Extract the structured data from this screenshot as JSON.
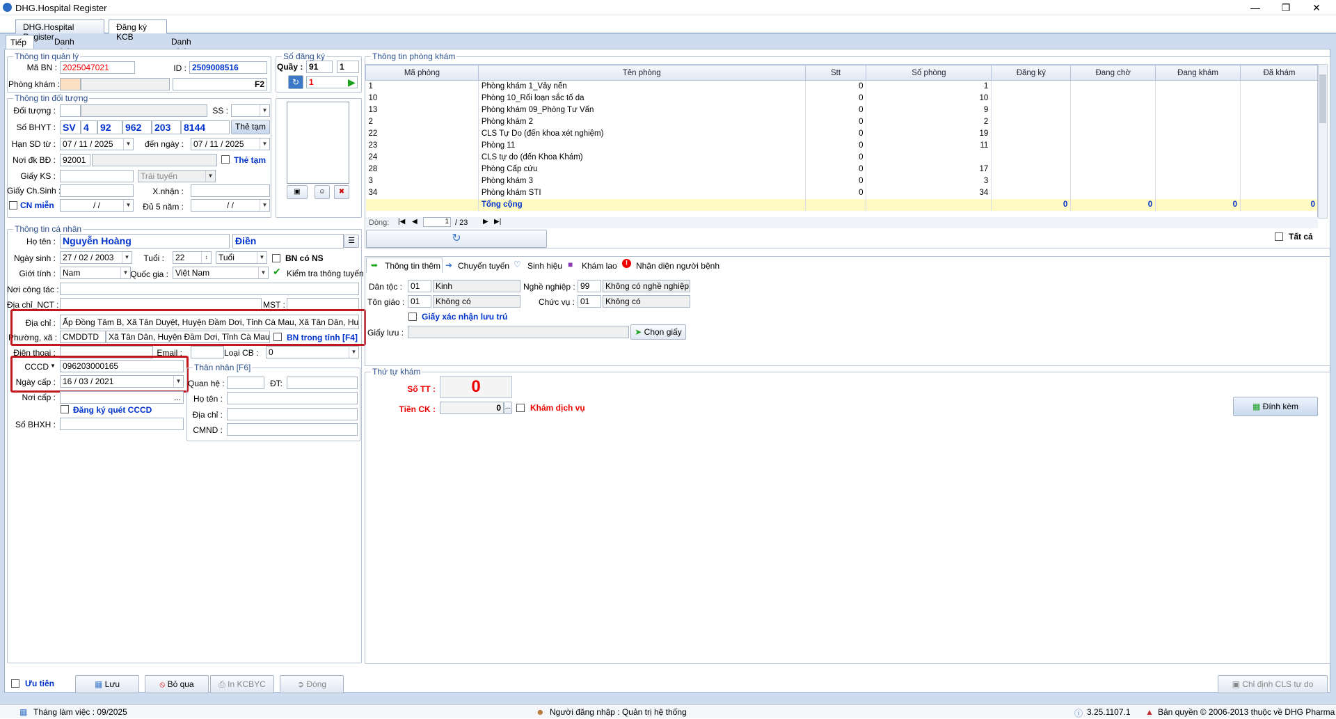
{
  "app": {
    "title": "DHG.Hospital Register"
  },
  "tabs": [
    "DHG.Hospital Register",
    "Đăng ký KCB"
  ],
  "subtabs": [
    "Tiếp nhận",
    "Danh sách bệnh nhân đăng ký",
    "Danh sách bệnh nhân WEB"
  ],
  "quanly": {
    "caption": "Thông tin quản lý",
    "ma_bn_label": "Mã BN :",
    "ma_bn": "2025047021",
    "id_label": "ID :",
    "id": "2509008516",
    "phong_kham_label": "Phòng khám :",
    "f2": "F2"
  },
  "sodangky": {
    "caption": "Số đăng ký",
    "quay_label": "Quầy :",
    "quay": "91",
    "quay2": "1",
    "so": "1"
  },
  "doituong": {
    "caption": "Thông tin đối tượng",
    "doi_tuong_label": "Đối tượng :",
    "ss_label": "SS :",
    "so_bhyt_label": "Số BHYT :",
    "bhyt": [
      "SV",
      "4",
      "92",
      "962",
      "203",
      "8144"
    ],
    "the_tam_btn": "Thẻ tạm",
    "han_sd_label": "Hạn SD từ :",
    "han_tu": "07 / 11 / 2025",
    "den_ngay_label": "đến ngày :",
    "han_den": "07 / 11 / 2025",
    "noi_dk_label": "Nơi đk BĐ :",
    "noi_dk": "92001",
    "the_tam_chk": "Thẻ tạm",
    "giay_ks_label": "Giấy KS :",
    "trai_tuyen": "Trái tuyến",
    "giay_chsinh_label": "Giấy Ch.Sinh :",
    "xnhan_label": "X.nhận :",
    "cn_mien": "CN miễn",
    "cn_date": "  /    /",
    "du5nam_label": "Đủ 5 năm :",
    "du5_date": "  /    /"
  },
  "canhan": {
    "caption": "Thông tin cá nhân",
    "ho_ten_label": "Họ tên :",
    "ho_ten": "Nguyễn Hoàng",
    "ten": "Điền",
    "ngay_sinh_label": "Ngày sinh :",
    "ngay_sinh": "27 / 02 / 2003",
    "tuoi_label": "Tuổi :",
    "tuoi": "22",
    "tuoi_unit": "Tuổi",
    "bn_co_ns": "BN có NS",
    "gioi_tinh_label": "Giới tính :",
    "gioi_tinh": "Nam",
    "quoc_gia_label": "Quốc gia :",
    "quoc_gia": "Việt Nam",
    "kiem_tra": "Kiểm tra thông tuyến",
    "noi_cong_tac_label": "Nơi công tác :",
    "dia_chi_nct_label": "Địa chỉ_NCT :",
    "mst_label": "MST :",
    "dia_chi_label": "Địa chỉ :",
    "dia_chi": "Ấp Đồng Tâm B, Xã Tân Duyệt, Huyện Đầm Dơi, Tỉnh Cà Mau, Xã Tân Dân, Huyện Đầm",
    "phuong_xa_label": "Phường, xã :",
    "phuong_xa_code": "CMDDTD",
    "phuong_xa": "Xã Tân Dân, Huyện Đầm Dơi, Tỉnh Cà Mau",
    "bn_trong_tinh": "BN trong tỉnh [F4]",
    "dien_thoai_label": "Điện thoại :",
    "email_label": "Email :",
    "loai_cb_label": "Loại CB :",
    "loai_cb": "0",
    "cccd_label": "CCCD",
    "cccd": "096203000165",
    "ngay_cap_label": "Ngày cấp :",
    "ngay_cap": "16 / 03 / 2021",
    "noi_cap_label": "Nơi cấp :",
    "dk_quet": "Đăng ký quét CCCD",
    "so_bhxh_label": "Số BHXH :"
  },
  "thannhan": {
    "caption": "Thân nhân [F6]",
    "quan_he_label": "Quan hệ :",
    "dt_label": "ĐT:",
    "ho_ten_label": "Họ tên :",
    "dia_chi_label": "Địa chỉ :",
    "cmnd_label": "CMND :"
  },
  "phongkham": {
    "caption": "Thông tin phòng khám",
    "columns": [
      "Mã phòng",
      "Tên phòng",
      "Stt",
      "Số phòng",
      "Đăng ký",
      "Đang chờ",
      "Đang khám",
      "Đã khám"
    ],
    "rows": [
      [
        "1",
        "Phòng khám 1_Vảy nến",
        "0",
        "1"
      ],
      [
        "10",
        "Phòng 10_Rối loạn sắc tố da",
        "0",
        "10"
      ],
      [
        "13",
        "Phòng khám 09_Phòng Tư Vấn",
        "0",
        "9"
      ],
      [
        "2",
        "Phòng khám 2",
        "0",
        "2"
      ],
      [
        "22",
        "CLS Tự Do (đến khoa xét nghiệm)",
        "0",
        "19"
      ],
      [
        "23",
        "Phòng 11",
        "0",
        "11"
      ],
      [
        "24",
        "CLS tự do (đến Khoa Khám)",
        "0",
        ""
      ],
      [
        "28",
        "Phòng Cấp cứu",
        "0",
        "17"
      ],
      [
        "3",
        "Phòng khám 3",
        "0",
        "3"
      ],
      [
        "34",
        "Phòng khám STI",
        "0",
        "34"
      ]
    ],
    "total_label": "Tổng cộng",
    "totals": [
      "0",
      "0",
      "0",
      "0"
    ],
    "dong_label": "Dòng:",
    "page": "1",
    "page_total": "/ 23",
    "tat_ca": "Tất cả"
  },
  "infotabs": [
    "Thông tin thêm",
    "Chuyển tuyến",
    "Sinh hiệu",
    "Khám lao",
    "Nhận diện người bệnh"
  ],
  "thongtinthem": {
    "dan_toc_label": "Dân tộc :",
    "dan_toc_code": "01",
    "dan_toc": "Kinh",
    "nghe_nghiep_label": "Nghề nghiệp :",
    "nghe_code": "99",
    "nghe": "Không có nghề nghiệp cụ",
    "ton_giao_label": "Tôn giáo :",
    "ton_code": "01",
    "ton": "Không có",
    "chuc_vu_label": "Chức vụ :",
    "chuc_code": "01",
    "chuc": "Không có",
    "giay_xn": "Giấy xác nhận lưu trú",
    "giay_luu_label": "Giấy lưu :",
    "chon_giay": "Chọn giấy"
  },
  "thutu": {
    "caption": "Thứ tự khám",
    "so_tt_label": "Số TT :",
    "so_tt": "0",
    "tien_ck_label": "Tiền CK :",
    "tien_ck": "0",
    "kham_dv": "Khám dịch vụ",
    "dinh_kem": "Đính kèm"
  },
  "bottom": {
    "uu_tien": "Ưu tiên",
    "luu": "Lưu",
    "bo_qua": "Bỏ qua",
    "in": "In KCBYC",
    "dong": "Đóng",
    "chi_dinh": "Chỉ định CLS tự do"
  },
  "status": {
    "thang": "Tháng làm việc : 09/2025",
    "nguoi": "Người đăng nhập : Quản trị hệ thống",
    "version": "3.25.1107.1",
    "ban_quyen": "Bản quyền © 2006-2013 thuộc về DHG Pharma"
  },
  "colors": {
    "highlight": "#c0181e",
    "accent_blue": "#0033cc",
    "total_row": "#fff9c4"
  }
}
